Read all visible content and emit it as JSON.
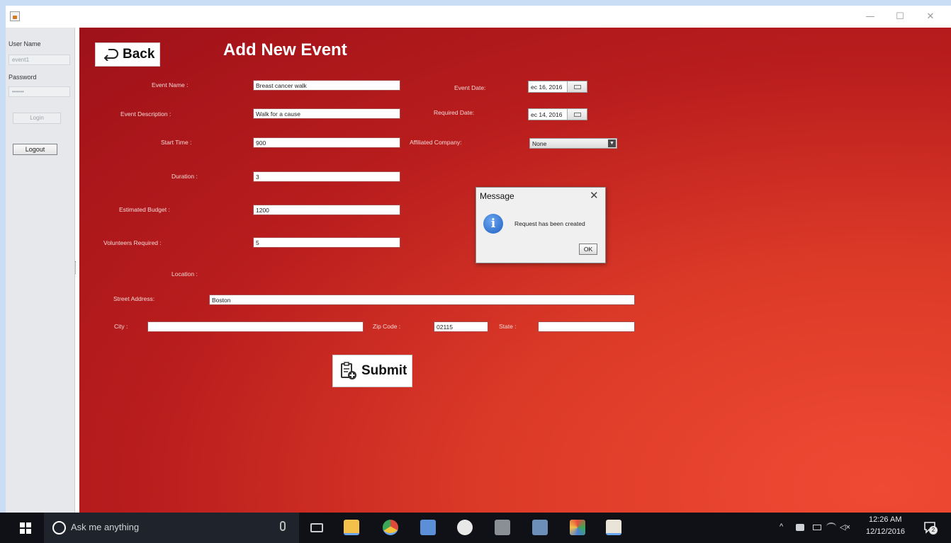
{
  "window": {
    "minimize": "—",
    "maximize": "☐",
    "close": "✕"
  },
  "left": {
    "username_label": "User Name",
    "username_value": "event1",
    "password_label": "Password",
    "password_value": "••••••",
    "login_label": "Login",
    "logout_label": "Logout"
  },
  "main": {
    "back_label": "Back",
    "title": "Add New Event",
    "fields": {
      "event_name_label": "Event Name :",
      "event_name_value": "Breast cancer walk",
      "event_desc_label": "Event Description :",
      "event_desc_value": "Walk for a cause",
      "start_time_label": "Start Time :",
      "start_time_value": "900",
      "duration_label": "Duration :",
      "duration_value": "3",
      "budget_label": "Estimated Budget :",
      "budget_value": "1200",
      "volunteers_label": "Volunteers Required :",
      "volunteers_value": "5",
      "location_label": "Location :",
      "street_label": "Street Address:",
      "street_value": "Boston",
      "city_label": "City :",
      "city_value": "",
      "zip_label": "Zip Code :",
      "zip_value": "02115",
      "state_label": "State :",
      "state_value": "",
      "event_date_label": "Event Date:",
      "event_date_value": "ec 16, 2016",
      "required_date_label": "Required Date:",
      "required_date_value": "ec 14, 2016",
      "affiliated_label": "Affiliated Company:",
      "affiliated_value": "None"
    },
    "submit_label": "Submit"
  },
  "dialog": {
    "title": "Message",
    "close": "✕",
    "message": "Request has been created",
    "ok_label": "OK",
    "info_glyph": "i"
  },
  "taskbar": {
    "search_placeholder": "Ask me anything",
    "time": "12:26 AM",
    "date": "12/12/2016",
    "notification_count": "2",
    "tray_up": "^",
    "tray_volume": "◁×"
  },
  "colors": {
    "panel_red": "#b91d1d",
    "accent_blue": "#1f5fc4"
  }
}
